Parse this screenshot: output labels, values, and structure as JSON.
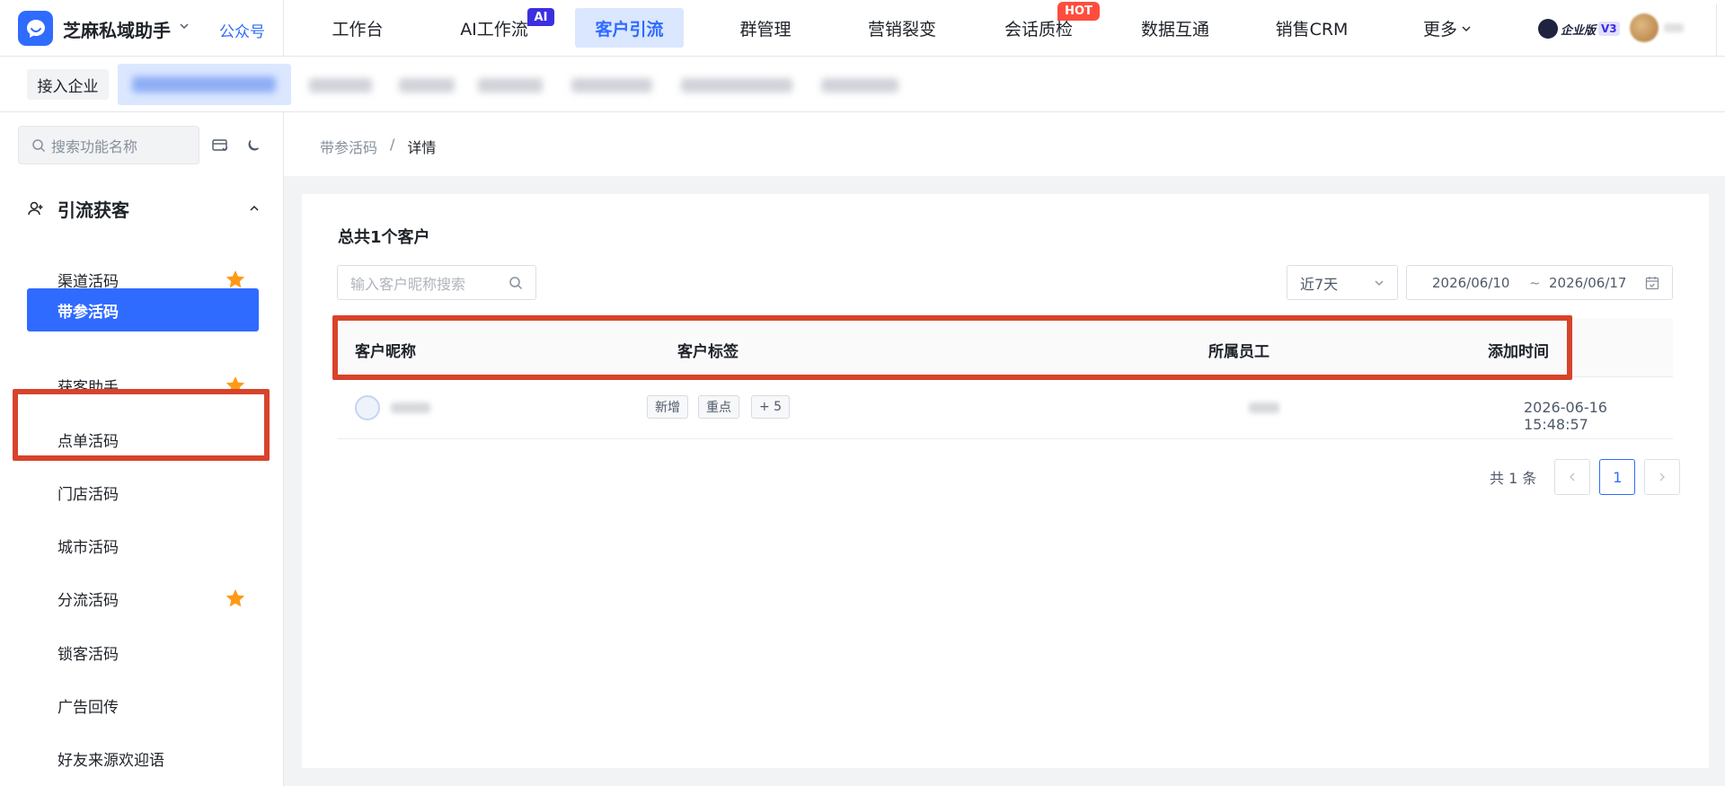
{
  "brand": {
    "name": "芝麻私域助手",
    "gzh": "公众号"
  },
  "nav": {
    "items": [
      "工作台",
      "AI工作流",
      "客户引流",
      "群管理",
      "营销裂变",
      "会话质检",
      "数据互通",
      "销售CRM",
      "更多"
    ],
    "active": "客户引流",
    "badge_ai": "AI",
    "badge_hot": "HOT",
    "enterprise_text": "企业版",
    "enterprise_version": "V3"
  },
  "subbar": {
    "join_label": "接入企业"
  },
  "sidebar": {
    "search_placeholder": "搜索功能名称",
    "group_title": "引流获客",
    "items": [
      {
        "label": "渠道活码",
        "starred": true
      },
      {
        "label": "带参活码",
        "starred": false,
        "selected": true
      },
      {
        "label": "获客助手",
        "starred": true
      },
      {
        "label": "点单活码",
        "starred": false
      },
      {
        "label": "门店活码",
        "starred": false
      },
      {
        "label": "城市活码",
        "starred": false
      },
      {
        "label": "分流活码",
        "starred": true
      },
      {
        "label": "锁客活码",
        "starred": false
      },
      {
        "label": "广告回传",
        "starred": false
      },
      {
        "label": "好友来源欢迎语",
        "starred": false
      }
    ]
  },
  "breadcrumb": {
    "parent": "带参活码",
    "sep": "/",
    "current": "详情"
  },
  "main": {
    "total_text": "总共1个客户",
    "search_placeholder": "输入客户昵称搜索",
    "range_value": "近7天",
    "date_start": "2026/06/10",
    "date_sep": "~",
    "date_end": "2026/06/17",
    "columns": [
      "客户昵称",
      "客户标签",
      "所属员工",
      "添加时间"
    ],
    "rows": [
      {
        "tags": [
          "新增",
          "重点",
          "+ 5"
        ],
        "added_time": "2026-06-16 15:48:57"
      }
    ],
    "pagination": {
      "total_text": "共 1 条",
      "current_page": "1"
    }
  },
  "colors": {
    "primary": "#2f6bff",
    "highlight": "#d8432b",
    "star": "#ff9a16"
  }
}
